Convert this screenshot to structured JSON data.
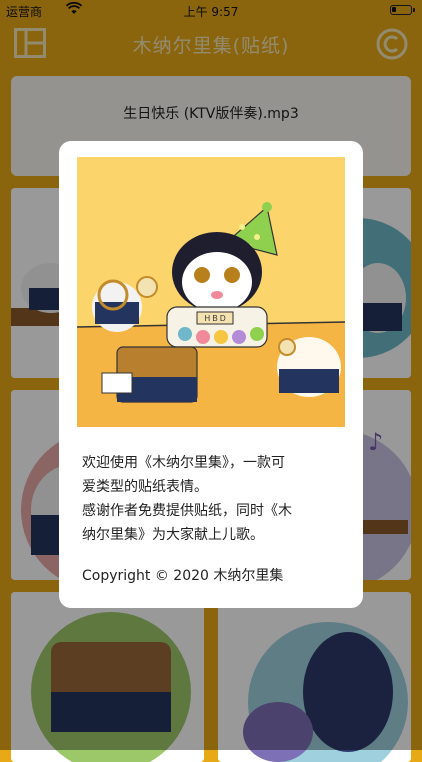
{
  "status_bar": {
    "carrier": "运营商",
    "time": "上午 9:57",
    "battery_level": 0.25
  },
  "nav": {
    "title": "木纳尔里集(贴纸)",
    "left_icon": "layout-grid-icon",
    "right_icon": "copyright-icon"
  },
  "player": {
    "track_name": "生日快乐 (KTV版伴奏).mp3",
    "controls": [
      "previous-icon",
      "play-icon",
      "next-icon"
    ]
  },
  "dialog": {
    "message_lines": [
      "欢迎使用《木纳尔里集》，一款可",
      "爱类型的贴纸表情。",
      "感谢作者免费提供贴纸，同时《木",
      "纳尔里集》为大家献上儿歌。"
    ],
    "copyright": "Copyright © 2020 木纳尔里集",
    "banner_text": "H B D"
  },
  "colors": {
    "accent": "#E7A818",
    "nav_text": "#F6E8B8",
    "illustration_bg": "#FBD56B"
  }
}
